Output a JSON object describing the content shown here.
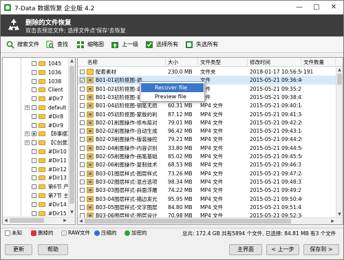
{
  "window": {
    "title": "7-Data 数据恢复 企业版 4.2",
    "controls": [
      "—",
      "□",
      "✕"
    ]
  },
  "banner": {
    "heading": "删除的文件恢复",
    "hint": "双击去预览文件; 选择文件点'保存'去恢复"
  },
  "toolbar": {
    "search": "搜索文件",
    "find": "查找",
    "thumbnails": "缩略图",
    "up": "上一级",
    "select_all": "选择所有",
    "unselect_all": "失选所有"
  },
  "tree": {
    "items": [
      {
        "label": "1045",
        "exp": false,
        "partial": false
      },
      {
        "label": "1036",
        "exp": false,
        "partial": false
      },
      {
        "label": "1038",
        "exp": false,
        "partial": false
      },
      {
        "label": "Client",
        "exp": false,
        "partial": false
      },
      {
        "label": "#Dir7",
        "exp": false,
        "partial": false
      },
      {
        "label": "default",
        "exp": true,
        "partial": false
      },
      {
        "label": "#Dir8",
        "exp": false,
        "partial": false
      },
      {
        "label": "#Dir9",
        "exp": false,
        "partial": false
      },
      {
        "label": "【B事摆】",
        "exp": true,
        "partial": true
      },
      {
        "label": "【C创意】",
        "exp": true,
        "partial": false
      },
      {
        "label": "#Dir10",
        "exp": false,
        "partial": false
      },
      {
        "label": "#Dir11",
        "exp": false,
        "partial": false
      },
      {
        "label": "#Dir12",
        "exp": false,
        "partial": false
      },
      {
        "label": "#Dir13",
        "exp": false,
        "partial": false
      },
      {
        "label": "第6节 产品",
        "exp": false,
        "partial": false
      },
      {
        "label": "第7节 主图",
        "exp": false,
        "partial": false
      },
      {
        "label": "#Dir14",
        "exp": false,
        "partial": false
      },
      {
        "label": "#Dir15",
        "exp": false,
        "partial": false
      }
    ]
  },
  "list": {
    "columns": [
      "名称",
      "大小",
      "文件类型",
      "修改时间",
      "文件数量"
    ],
    "rows": [
      {
        "name": "配套素材",
        "size": "230.0 MB",
        "type": "文件夹",
        "time": "2018-01-17 10:56:56",
        "count": "191",
        "icon": "folder",
        "checked": false
      },
      {
        "name": "B01-01初阶抠图-调",
        "size": "",
        "type": "文件",
        "time": "2015-05-21 09:36:46",
        "count": "",
        "icon": "mov",
        "checked": true
      },
      {
        "name": "B01-02初阶抠图-调",
        "size": "",
        "type": "文件",
        "time": "2015-05-21 09:35:27",
        "count": "",
        "icon": "mov",
        "checked": false
      },
      {
        "name": "B01-03初阶抠图-调",
        "size": "",
        "type": "文件",
        "time": "2015-05-21 09:38:42",
        "count": "",
        "icon": "mov",
        "checked": false
      },
      {
        "name": "B01-04初阶抠图-钢笔无损",
        "size": "60.31 MB",
        "type": "MP4 文件",
        "time": "2015-05-21 09:40:14",
        "count": "",
        "icon": "mov",
        "checked": false
      },
      {
        "name": "B01-05初阶抠图-蒙版的利",
        "size": "87.12 MB",
        "type": "MP4 文件",
        "time": "2015-05-21 09:41:34",
        "count": "",
        "icon": "mov",
        "checked": false
      },
      {
        "name": "B02-01削图操作-修布局对",
        "size": "79.01 MB",
        "type": "MP4 文件",
        "time": "2015-05-21 09:42:26",
        "count": "",
        "icon": "mov",
        "checked": false
      },
      {
        "name": "B02-02削图操作-自动生成",
        "size": "96.42 MB",
        "type": "MP4 文件",
        "time": "2015-05-21 09:43:14",
        "count": "",
        "icon": "mov",
        "checked": false
      },
      {
        "name": "B02-03削图操作-版装操控",
        "size": "79.21 MB",
        "type": "MP4 文件",
        "time": "2015-05-21 09:44:28",
        "count": "",
        "icon": "mov",
        "checked": false
      },
      {
        "name": "B02-04削图操作-内容识别",
        "size": "33.80 MB",
        "type": "MP4 文件",
        "time": "2015-05-21 09:44:56",
        "count": "",
        "icon": "mov",
        "checked": false
      },
      {
        "name": "B02-05削图操作-画笔基础",
        "size": "85.02 MB",
        "type": "MP4 文件",
        "time": "2015-05-21 09:45:50",
        "count": "",
        "icon": "mov",
        "checked": false
      },
      {
        "name": "B02-06削图操作-复制技术",
        "size": "68.53 MB",
        "type": "MP4 文件",
        "time": "2015-05-21 09:46:37",
        "count": "",
        "icon": "mov",
        "checked": false
      },
      {
        "name": "B03-01图层样式-图层样式",
        "size": "73.26 MB",
        "type": "MP4 文件",
        "time": "2015-05-21 09:47:24",
        "count": "",
        "icon": "mov",
        "checked": false
      },
      {
        "name": "B03-02图层样式-混合选项",
        "size": "98.34 MB",
        "type": "MP4 文件",
        "time": "2015-05-21 09:48:33",
        "count": "",
        "icon": "mov",
        "checked": false
      },
      {
        "name": "B03-03图层样式-斜面浮雕",
        "size": "74.22 MB",
        "type": "MP4 文件",
        "time": "2015-05-21 09:49:27",
        "count": "",
        "icon": "mov",
        "checked": false
      },
      {
        "name": "B03-04图层样式-描边发光",
        "size": "95.95 MB",
        "type": "MP4 文件",
        "time": "2015-05-21 09:50:40",
        "count": "",
        "icon": "mov",
        "checked": false
      },
      {
        "name": "B03-05图层样式-文字图层",
        "size": "84.80 MB",
        "type": "MP4 文件",
        "time": "2015-05-21 09:51:43",
        "count": "",
        "icon": "mov",
        "checked": false
      },
      {
        "name": "B03-06图层样式-图层设计",
        "size": "70.98 MB",
        "type": "MP4 文件",
        "time": "2015-05-21 09:52:34",
        "count": "",
        "icon": "mov",
        "checked": false
      }
    ]
  },
  "context_menu": {
    "recover": "Recover file",
    "preview": "Preview file"
  },
  "legend": {
    "unknown": "未知",
    "deleted": "删掉的",
    "raw": "RAW文件",
    "compressed": "压缩的",
    "encrypted": "加密的",
    "summary": "总共: 172.4 GB 共有5894 个文件, 已选择: 84.81 MB 有3 个文件"
  },
  "colors": {
    "unknown": "#ffffff",
    "deleted": "#e03030",
    "raw": "#e8e8e8",
    "compressed": "#2f6fd6",
    "encrypted": "#2ca52c",
    "banner": "#3e3e3e",
    "menu_highlight": "#3a77c8"
  },
  "buttons": {
    "refresh": "更新",
    "help": "帮助",
    "home": "主界面",
    "prev": "< 上一步",
    "save": "保存到 >"
  }
}
